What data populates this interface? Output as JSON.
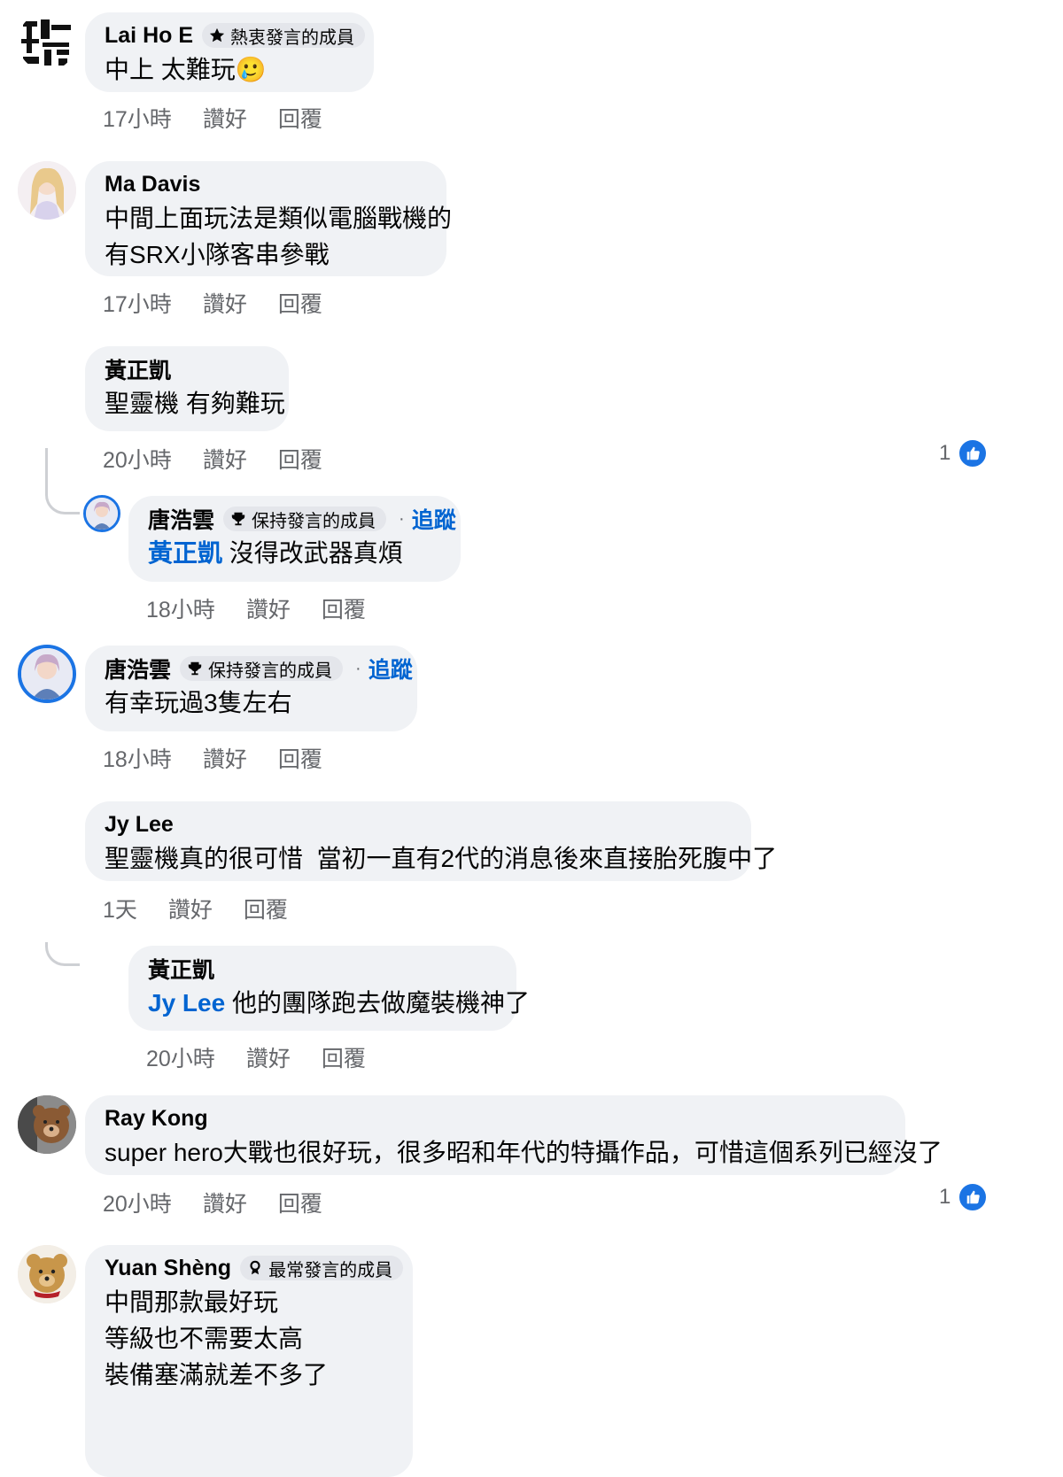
{
  "comments": [
    {
      "name": "Lai Ho E",
      "badge": "熱衷發言的成員",
      "lines": [
        "中上 太難玩🥲"
      ],
      "time": "17小時",
      "like": "讚好",
      "reply": "回覆"
    },
    {
      "name": "Ma Davis",
      "lines": [
        "中間上面玩法是類似電腦戰機的",
        "有SRX小隊客串參戰"
      ],
      "time": "17小時",
      "like": "讚好",
      "reply": "回覆"
    },
    {
      "name": "黃正凱",
      "lines": [
        "聖靈機 有夠難玩"
      ],
      "time": "20小時",
      "like": "讚好",
      "reply": "回覆",
      "reaction_count": "1"
    },
    {
      "name": "唐浩雲",
      "badge": "保持發言的成員",
      "follow": "追蹤",
      "mention": "黃正凱",
      "lines": [
        "沒得改武器真煩"
      ],
      "time": "18小時",
      "like": "讚好",
      "reply": "回覆"
    },
    {
      "name": "唐浩雲",
      "badge": "保持發言的成員",
      "follow": "追蹤",
      "lines": [
        "有幸玩過3隻左右"
      ],
      "time": "18小時",
      "like": "讚好",
      "reply": "回覆"
    },
    {
      "name": "Jy Lee",
      "lines": [
        "聖靈機真的很可惜  當初一直有2代的消息後來直接胎死腹中了"
      ],
      "time": "1天",
      "like": "讚好",
      "reply": "回覆"
    },
    {
      "name": "黃正凱",
      "mention": "Jy Lee",
      "lines": [
        "他的團隊跑去做魔裝機神了"
      ],
      "time": "20小時",
      "like": "讚好",
      "reply": "回覆"
    },
    {
      "name": "Ray Kong",
      "lines": [
        "super hero大戰也很好玩，很多昭和年代的特攝作品，可惜這個系列已經沒了"
      ],
      "time": "20小時",
      "like": "讚好",
      "reply": "回覆",
      "reaction_count": "1"
    },
    {
      "name": "Yuan Shèng",
      "badge": "最常發言的成員",
      "lines": [
        "中間那款最好玩",
        "等級也不需要太高",
        "裝備塞滿就差不多了"
      ]
    }
  ],
  "colors": {
    "bubble": "#f0f2f5",
    "link": "#0064d1",
    "meta": "#65676b",
    "like_blue": "#1b74e4"
  }
}
